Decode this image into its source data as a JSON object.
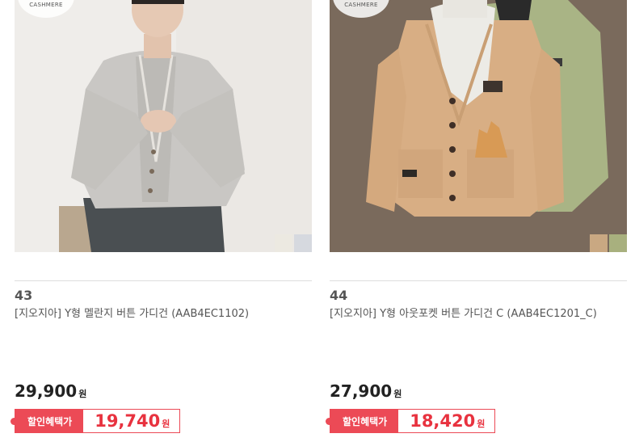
{
  "products": [
    {
      "badge": "CASHMERE",
      "number": "43",
      "title": "[지오지아] Y형 멜란지 버튼 가디건 (AAB4EC1102)",
      "price": "29,900",
      "currency": "원",
      "discount_label": "할인혜택가",
      "discount_price": "19,740",
      "swatches": [
        "#ece9e1",
        "#d6d9df"
      ],
      "image": "man-wearing-gray-cardigan"
    },
    {
      "badge": "CASHMERE",
      "number": "44",
      "title": "[지오지아] Y형 아웃포켓 버튼 가디건 C (AAB4EC1201_C)",
      "price": "27,900",
      "currency": "원",
      "discount_label": "할인혜택가",
      "discount_price": "18,420",
      "swatches": [
        "#c9a882",
        "#a8b07e"
      ],
      "image": "beige-and-green-cardigans-on-hangers"
    }
  ],
  "colors": {
    "accent": "#ec4a56",
    "discount_text": "#e8323f"
  }
}
